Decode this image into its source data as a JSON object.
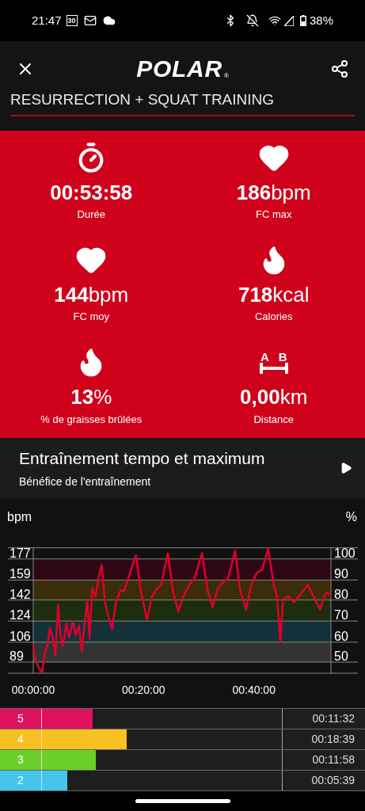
{
  "status_bar": {
    "time": "21:47",
    "calendar_day": "30",
    "battery": "38%"
  },
  "app_bar": {
    "logo": "POLAR",
    "logo_mark": "®"
  },
  "title": "RESURRECTION + SQUAT TRAINING",
  "stats": [
    {
      "kind": "stopwatch",
      "value": "**00:53:58**",
      "label": "Durée"
    },
    {
      "kind": "heart",
      "value": "**186**bpm",
      "label": "FC max"
    },
    {
      "kind": "heart",
      "value": "**144**bpm",
      "label": "FC moy"
    },
    {
      "kind": "flame",
      "value": "**718**kcal",
      "label": "Calories"
    },
    {
      "kind": "flame",
      "value": "**13**%",
      "label": "% de graisses brûlées"
    },
    {
      "kind": "distance",
      "value": "**0,00**km",
      "label": "Distance"
    }
  ],
  "distance_icon_letters": [
    "A",
    "B"
  ],
  "benefit": {
    "title": "Entraînement tempo et maximum",
    "subtitle": "Bénéfice de l'entraînement"
  },
  "hr_chart": {
    "right_unit": "%",
    "right_labels": [
      "100",
      "90",
      "80",
      "70",
      "60",
      "50"
    ],
    "chart_data": {
      "type": "line",
      "ylabel": "bpm",
      "grid": true,
      "bands": [
        {
          "axis": "y",
          "from": 159,
          "to": 177,
          "color": "#2e0716"
        },
        {
          "axis": "y",
          "from": 142,
          "to": 159,
          "color": "#3a2d0a"
        },
        {
          "axis": "y",
          "from": 124,
          "to": 142,
          "color": "#1c2e0e"
        },
        {
          "axis": "y",
          "from": 106,
          "to": 124,
          "color": "#14303a"
        },
        {
          "axis": "y",
          "from": 89,
          "to": 106,
          "color": "#333333"
        }
      ],
      "xlim": [
        0,
        53.97
      ],
      "ylim": [
        79.5,
        186.5
      ],
      "xticks": [
        {
          "value": 0,
          "label": "00:00:00"
        },
        {
          "value": 20,
          "label": "00:20:00"
        },
        {
          "value": 40,
          "label": "00:40:00"
        }
      ],
      "yticks": [
        177,
        159,
        142,
        124,
        106,
        89
      ],
      "x": [
        0,
        0.3,
        0.8,
        1.6,
        2.1,
        2.6,
        3.0,
        3.4,
        3.8,
        4.0,
        4.5,
        4.9,
        5.4,
        6.0,
        6.5,
        7.2,
        7.7,
        8.3,
        8.8,
        9.3,
        9.8,
        10.2,
        10.7,
        11.3,
        11.8,
        12.4,
        13.0,
        13.6,
        14.3,
        15.0,
        15.8,
        16.5,
        17.2,
        18.6,
        19.5,
        20.6,
        21.5,
        22.5,
        23.2,
        24.4,
        25.3,
        26.3,
        27.2,
        28.3,
        29.2,
        30.6,
        31.6,
        32.5,
        33.5,
        34.5,
        35.3,
        36.6,
        37.5,
        38.6,
        39.5,
        40.5,
        41.5,
        42.6,
        43.6,
        44.2,
        44.8,
        45.3,
        46.3,
        47.3,
        48.3,
        49.8,
        50.8,
        52.0,
        53.0,
        53.9
      ],
      "series": [
        {
          "color": "#e0002a",
          "values": [
            103,
            92,
            86,
            80,
            97,
            104,
            118,
            112,
            103,
            95,
            138,
            113,
            103,
            122,
            110,
            124,
            112,
            120,
            98,
            122,
            142,
            109,
            152,
            145,
            160,
            172,
            140,
            128,
            117,
            140,
            150,
            150,
            160,
            180,
            150,
            125,
            145,
            152,
            155,
            182,
            150,
            132,
            145,
            155,
            160,
            182,
            150,
            136,
            152,
            158,
            160,
            184,
            150,
            134,
            155,
            165,
            168,
            186,
            155,
            145,
            106,
            143,
            145,
            140,
            146,
            155,
            145,
            134,
            148,
            147
          ]
        }
      ]
    }
  },
  "zones": [
    {
      "zone": "5",
      "color": "#e0115f",
      "level": 0.33,
      "time": "00:11:32"
    },
    {
      "zone": "4",
      "color": "#f9c021",
      "level": 0.45,
      "time": "00:18:39"
    },
    {
      "zone": "3",
      "color": "#6ccf2b",
      "level": 0.34,
      "time": "00:11:58"
    },
    {
      "zone": "2",
      "color": "#44c6ec",
      "level": 0.24,
      "time": "00:05:39"
    }
  ]
}
